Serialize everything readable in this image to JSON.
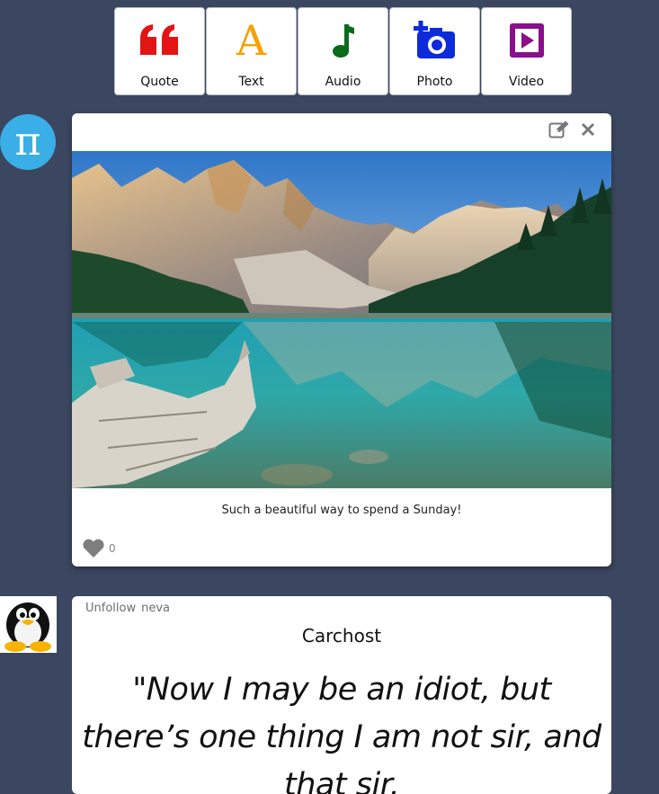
{
  "toolbar": {
    "buttons": [
      {
        "label": "Quote",
        "icon": "quote-icon",
        "color": "#e31414"
      },
      {
        "label": "Text",
        "icon": "text-a-icon",
        "color": "#f7a000"
      },
      {
        "label": "Audio",
        "icon": "music-note-icon",
        "color": "#0b6b1c"
      },
      {
        "label": "Photo",
        "icon": "camera-plus-icon",
        "color": "#0d2bd9"
      },
      {
        "label": "Video",
        "icon": "play-square-icon",
        "color": "#8a0f8a"
      }
    ],
    "text_glyph": "A"
  },
  "avatars": {
    "first": {
      "glyph": "π",
      "color": "#3aaee6"
    },
    "second": {
      "icon": "penguin-icon"
    }
  },
  "photo_post": {
    "image": "mountain-lake-photo",
    "caption": "Such a beautiful way to spend a Sunday!",
    "likes": "0",
    "actions": [
      "edit-icon",
      "close-icon"
    ]
  },
  "quote_post": {
    "unfollow_label": "Unfollow",
    "username": "neva",
    "title": "Carchost",
    "quote_text": "\"Now I may be an idiot, but there’s one thing I am not sir, and that sir,"
  }
}
